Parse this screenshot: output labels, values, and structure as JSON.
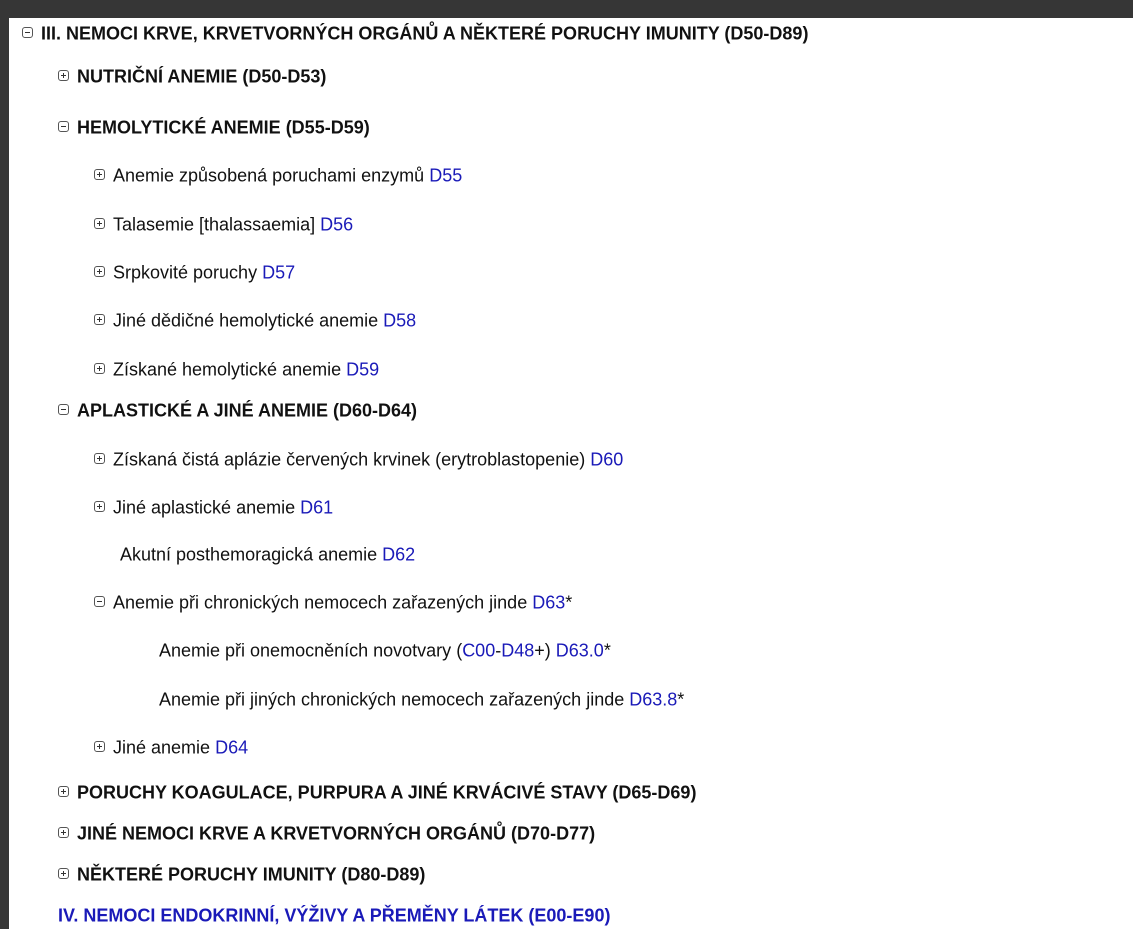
{
  "tree": {
    "chapter3": {
      "toggle": "minus",
      "label": "III. NEMOCI KRVE, KRVETVORNÝCH ORGÁNŮ A NĚKTERÉ PORUCHY IMUNITY (D50-D89)"
    },
    "g1": {
      "toggle": "plus",
      "label": "NUTRIČNÍ ANEMIE (D50-D53)"
    },
    "g2": {
      "toggle": "minus",
      "label": "HEMOLYTICKÉ ANEMIE (D55-D59)",
      "items": [
        {
          "toggle": "plus",
          "label": "Anemie způsobená poruchami enzymů",
          "code": "D55"
        },
        {
          "toggle": "plus",
          "label": "Talasemie [thalassaemia]",
          "code": "D56"
        },
        {
          "toggle": "plus",
          "label": "Srpkovité poruchy",
          "code": "D57"
        },
        {
          "toggle": "plus",
          "label": "Jiné dědičné hemolytické anemie",
          "code": "D58"
        },
        {
          "toggle": "plus",
          "label": "Získané hemolytické anemie",
          "code": "D59"
        }
      ]
    },
    "g3": {
      "toggle": "minus",
      "label": "APLASTICKÉ A JINÉ ANEMIE (D60-D64)",
      "items": [
        {
          "toggle": "plus",
          "label": "Získaná čistá aplázie červených krvinek (erytroblastopenie)",
          "code": "D60"
        },
        {
          "toggle": "plus",
          "label": "Jiné aplastické anemie",
          "code": "D61"
        },
        {
          "toggle": "none",
          "label": "Akutní posthemoragická anemie",
          "code": "D62"
        },
        {
          "toggle": "minus",
          "label": "Anemie při chronických nemocech zařazených jinde",
          "code": "D63",
          "suffix": "*",
          "children": [
            {
              "label": "Anemie při onemocněních novotvary",
              "paren_open": "(",
              "ref1": "C00",
              "dash": "-",
              "ref2": "D48",
              "ref_suffix": "+)",
              "code": "D63.0",
              "suffix": "*"
            },
            {
              "label": "Anemie při jiných chronických nemocech zařazených jinde",
              "code": "D63.8",
              "suffix": "*"
            }
          ]
        },
        {
          "toggle": "plus",
          "label": "Jiné anemie",
          "code": "D64"
        }
      ]
    },
    "g4": {
      "toggle": "plus",
      "label": "PORUCHY KOAGULACE, PURPURA A JINÉ KRVÁCIVÉ STAVY (D65-D69)"
    },
    "g5": {
      "toggle": "plus",
      "label": "JINÉ NEMOCI KRVE A KRVETVORNÝCH ORGÁNŮ (D70-D77)"
    },
    "g6": {
      "toggle": "plus",
      "label": "NĚKTERÉ PORUCHY IMUNITY (D80-D89)"
    },
    "chapter4": {
      "label": "IV. NEMOCI ENDOKRINNÍ, VÝŽIVY A PŘEMĚNY LÁTEK (E00-E90)"
    }
  }
}
